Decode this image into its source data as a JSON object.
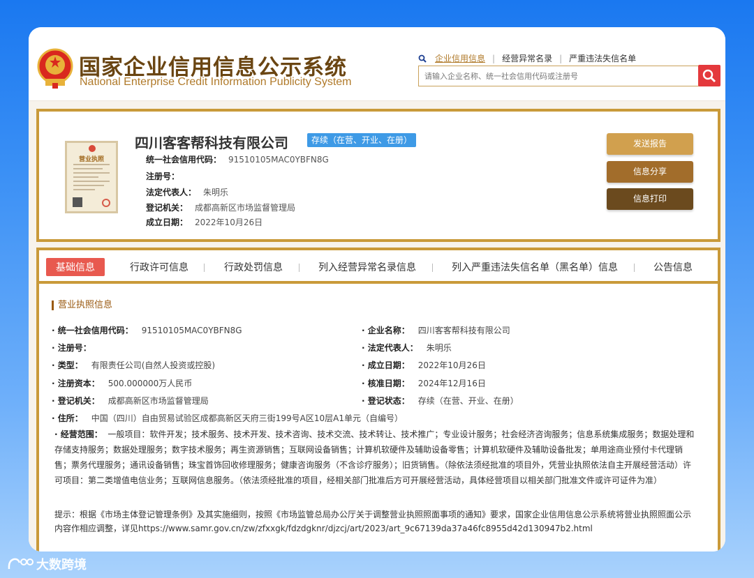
{
  "header": {
    "title_cn": "国家企业信用信息公示系统",
    "title_en": "National Enterprise Credit Information Publicity System",
    "links": [
      "企业信用信息",
      "经营异常名录",
      "严重违法失信名单"
    ],
    "search_placeholder": "请输入企业名称、统一社会信用代码或注册号"
  },
  "company": {
    "name": "四川客客帮科技有限公司",
    "status": "存续（在营、开业、在册）",
    "license_label": "营业执照",
    "fields": [
      {
        "k": "统一社会信用代码：",
        "v": "91510105MAC0YBFN8G"
      },
      {
        "k": "注册号：",
        "v": ""
      },
      {
        "k": "法定代表人：",
        "v": "朱明乐"
      },
      {
        "k": "登记机关：",
        "v": "成都高新区市场监督管理局"
      },
      {
        "k": "成立日期：",
        "v": "2022年10月26日"
      }
    ],
    "buttons": [
      "发送报告",
      "信息分享",
      "信息打印"
    ]
  },
  "tabs": [
    "基础信息",
    "行政许可信息",
    "行政处罚信息",
    "列入经营异常名录信息",
    "列入严重违法失信名单（黑名单）信息",
    "公告信息"
  ],
  "license_info": {
    "section_title": "营业执照信息",
    "left": [
      {
        "k": "· 统一社会信用代码：",
        "v": "91510105MAC0YBFN8G"
      },
      {
        "k": "· 注册号：",
        "v": ""
      },
      {
        "k": "· 类型：",
        "v": "有限责任公司(自然人投资或控股)"
      },
      {
        "k": "· 注册资本：",
        "v": "500.000000万人民币"
      },
      {
        "k": "· 登记机关：",
        "v": "成都高新区市场监督管理局"
      }
    ],
    "right": [
      {
        "k": "· 企业名称：",
        "v": "四川客客帮科技有限公司"
      },
      {
        "k": "· 法定代表人：",
        "v": "朱明乐"
      },
      {
        "k": "· 成立日期：",
        "v": "2022年10月26日"
      },
      {
        "k": "· 核准日期：",
        "v": "2024年12月16日"
      },
      {
        "k": "· 登记状态：",
        "v": "存续（在营、开业、在册）"
      }
    ],
    "address_k": "· 住所：",
    "address_v": "中国（四川）自由贸易试验区成都高新区天府三街199号A区10层A1单元（自编号）",
    "scope_k": "· 经营范围：",
    "scope_v": "一般项目：软件开发；技术服务、技术开发、技术咨询、技术交流、技术转让、技术推广；专业设计服务；社会经济咨询服务；信息系统集成服务；数据处理和存储支持服务；数据处理服务；数字技术服务；再生资源销售；互联网设备销售；计算机软硬件及辅助设备零售；计算机软硬件及辅助设备批发；单用途商业预付卡代理销售；票务代理服务；通讯设备销售；珠宝首饰回收修理服务；健康咨询服务（不含诊疗服务）；旧货销售。（除依法须经批准的项目外，凭营业执照依法自主开展经营活动）许可项目：第二类增值电信业务；互联网信息服务。（依法须经批准的项目，经相关部门批准后方可开展经营活动，具体经营项目以相关部门批准文件或许可证件为准）",
    "tip": "提示：根据《市场主体登记管理条例》及其实施细则，按照《市场监管总局办公厅关于调整营业执照照面事项的通知》要求，国家企业信用信息公示系统将营业执照照面公示内容作相应调整，详见https://www.samr.gov.cn/zw/zfxxgk/fdzdgknr/djzcj/art/2023/art_9c67139da37a46fc8955d42d130947b2.html"
  },
  "watermark": "大数跨境",
  "colors": {
    "gold_border": "#c99a3a",
    "brown_text": "#6a4512",
    "active_tab": "#e8594f",
    "badge": "#3e9ae6",
    "search_btn": "#e4393c"
  }
}
